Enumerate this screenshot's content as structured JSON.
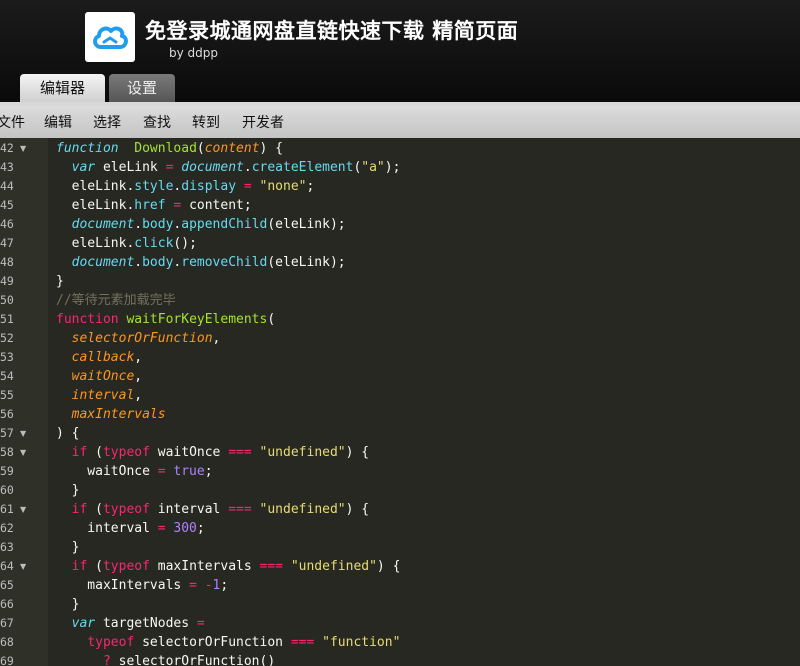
{
  "header": {
    "title": "免登录城通网盘直链快速下载 精简页面",
    "subtitle": "by ddpp",
    "logo_icon": "cloud-logo-icon",
    "logo_color": "#1e9ef0"
  },
  "tabs": [
    {
      "label": "编辑器",
      "active": true
    },
    {
      "label": "设置",
      "active": false
    }
  ],
  "menu": [
    "文件",
    "编辑",
    "选择",
    "查找",
    "转到",
    "开发者"
  ],
  "editor": {
    "lines": [
      {
        "n": "42",
        "fold": true,
        "tokens": [
          [
            "kw",
            "function"
          ],
          [
            "",
            "  "
          ],
          [
            "fn",
            "Download"
          ],
          [
            "",
            "("
          ],
          [
            "param",
            "content"
          ],
          [
            "",
            ") {"
          ]
        ]
      },
      {
        "n": "43",
        "fold": false,
        "tokens": [
          [
            "",
            "  "
          ],
          [
            "kw",
            "var"
          ],
          [
            "",
            " eleLink "
          ],
          [
            "kw2",
            "="
          ],
          [
            "",
            " "
          ],
          [
            "blt",
            "document"
          ],
          [
            "",
            "."
          ],
          [
            "prop",
            "createElement"
          ],
          [
            "",
            "("
          ],
          [
            "str",
            "\"a\""
          ],
          [
            "",
            ");"
          ]
        ]
      },
      {
        "n": "44",
        "fold": false,
        "tokens": [
          [
            "",
            "  eleLink."
          ],
          [
            "prop",
            "style"
          ],
          [
            "",
            "."
          ],
          [
            "prop",
            "display"
          ],
          [
            "",
            " "
          ],
          [
            "kw2",
            "="
          ],
          [
            "",
            " "
          ],
          [
            "str",
            "\"none\""
          ],
          [
            "",
            ";"
          ]
        ]
      },
      {
        "n": "45",
        "fold": false,
        "tokens": [
          [
            "",
            "  eleLink."
          ],
          [
            "prop",
            "href"
          ],
          [
            "",
            " "
          ],
          [
            "kw2",
            "="
          ],
          [
            "",
            " content;"
          ]
        ]
      },
      {
        "n": "46",
        "fold": false,
        "tokens": [
          [
            "",
            "  "
          ],
          [
            "blt",
            "document"
          ],
          [
            "",
            "."
          ],
          [
            "prop",
            "body"
          ],
          [
            "",
            "."
          ],
          [
            "prop",
            "appendChild"
          ],
          [
            "",
            "(eleLink);"
          ]
        ]
      },
      {
        "n": "47",
        "fold": false,
        "tokens": [
          [
            "",
            "  eleLink."
          ],
          [
            "prop",
            "click"
          ],
          [
            "",
            "();"
          ]
        ]
      },
      {
        "n": "48",
        "fold": false,
        "tokens": [
          [
            "",
            "  "
          ],
          [
            "blt",
            "document"
          ],
          [
            "",
            "."
          ],
          [
            "prop",
            "body"
          ],
          [
            "",
            "."
          ],
          [
            "prop",
            "removeChild"
          ],
          [
            "",
            "(eleLink);"
          ]
        ]
      },
      {
        "n": "49",
        "fold": false,
        "tokens": [
          [
            "",
            "}"
          ]
        ]
      },
      {
        "n": "50",
        "fold": false,
        "tokens": [
          [
            "cm",
            "//等待元素加载完毕"
          ]
        ]
      },
      {
        "n": "51",
        "fold": false,
        "tokens": [
          [
            "kw2",
            "function"
          ],
          [
            "",
            " "
          ],
          [
            "fn",
            "waitForKeyElements"
          ],
          [
            "",
            "("
          ]
        ]
      },
      {
        "n": "52",
        "fold": false,
        "tokens": [
          [
            "",
            "  "
          ],
          [
            "param",
            "selectorOrFunction"
          ],
          [
            "",
            ","
          ]
        ]
      },
      {
        "n": "53",
        "fold": false,
        "tokens": [
          [
            "",
            "  "
          ],
          [
            "param",
            "callback"
          ],
          [
            "",
            ","
          ]
        ]
      },
      {
        "n": "54",
        "fold": false,
        "tokens": [
          [
            "",
            "  "
          ],
          [
            "param",
            "waitOnce"
          ],
          [
            "",
            ","
          ]
        ]
      },
      {
        "n": "55",
        "fold": false,
        "tokens": [
          [
            "",
            "  "
          ],
          [
            "param",
            "interval"
          ],
          [
            "",
            ","
          ]
        ]
      },
      {
        "n": "56",
        "fold": false,
        "tokens": [
          [
            "",
            "  "
          ],
          [
            "param",
            "maxIntervals"
          ]
        ]
      },
      {
        "n": "57",
        "fold": true,
        "tokens": [
          [
            "",
            ") {"
          ]
        ]
      },
      {
        "n": "58",
        "fold": true,
        "tokens": [
          [
            "",
            "  "
          ],
          [
            "kw2",
            "if"
          ],
          [
            "",
            " ("
          ],
          [
            "kw2",
            "typeof"
          ],
          [
            "",
            " waitOnce "
          ],
          [
            "kw2",
            "==="
          ],
          [
            "",
            " "
          ],
          [
            "str",
            "\"undefined\""
          ],
          [
            "",
            ") {"
          ]
        ]
      },
      {
        "n": "59",
        "fold": false,
        "tokens": [
          [
            "",
            "    waitOnce "
          ],
          [
            "kw2",
            "="
          ],
          [
            "",
            " "
          ],
          [
            "bool",
            "true"
          ],
          [
            "",
            ";"
          ]
        ]
      },
      {
        "n": "60",
        "fold": false,
        "tokens": [
          [
            "",
            "  }"
          ]
        ]
      },
      {
        "n": "61",
        "fold": true,
        "tokens": [
          [
            "",
            "  "
          ],
          [
            "kw2",
            "if"
          ],
          [
            "",
            " ("
          ],
          [
            "kw2",
            "typeof"
          ],
          [
            "",
            " interval "
          ],
          [
            "kw2",
            "==="
          ],
          [
            "",
            " "
          ],
          [
            "str",
            "\"undefined\""
          ],
          [
            "",
            ") {"
          ]
        ]
      },
      {
        "n": "62",
        "fold": false,
        "tokens": [
          [
            "",
            "    interval "
          ],
          [
            "kw2",
            "="
          ],
          [
            "",
            " "
          ],
          [
            "num",
            "300"
          ],
          [
            "",
            ";"
          ]
        ]
      },
      {
        "n": "63",
        "fold": false,
        "tokens": [
          [
            "",
            "  }"
          ]
        ]
      },
      {
        "n": "64",
        "fold": true,
        "tokens": [
          [
            "",
            "  "
          ],
          [
            "kw2",
            "if"
          ],
          [
            "",
            " ("
          ],
          [
            "kw2",
            "typeof"
          ],
          [
            "",
            " maxIntervals "
          ],
          [
            "kw2",
            "==="
          ],
          [
            "",
            " "
          ],
          [
            "str",
            "\"undefined\""
          ],
          [
            "",
            ") {"
          ]
        ]
      },
      {
        "n": "65",
        "fold": false,
        "tokens": [
          [
            "",
            "    maxIntervals "
          ],
          [
            "kw2",
            "="
          ],
          [
            "",
            " "
          ],
          [
            "kw2",
            "-"
          ],
          [
            "num",
            "1"
          ],
          [
            "",
            ";"
          ]
        ]
      },
      {
        "n": "66",
        "fold": false,
        "tokens": [
          [
            "",
            "  }"
          ]
        ]
      },
      {
        "n": "67",
        "fold": false,
        "tokens": [
          [
            "",
            "  "
          ],
          [
            "kw",
            "var"
          ],
          [
            "",
            " targetNodes "
          ],
          [
            "kw2",
            "="
          ]
        ]
      },
      {
        "n": "68",
        "fold": false,
        "tokens": [
          [
            "",
            "    "
          ],
          [
            "kw2",
            "typeof"
          ],
          [
            "",
            " selectorOrFunction "
          ],
          [
            "kw2",
            "==="
          ],
          [
            "",
            " "
          ],
          [
            "str",
            "\"function\""
          ]
        ]
      },
      {
        "n": "69",
        "fold": false,
        "tokens": [
          [
            "",
            "      "
          ],
          [
            "kw2",
            "?"
          ],
          [
            "",
            " selectorOrFunction()"
          ]
        ]
      }
    ]
  }
}
